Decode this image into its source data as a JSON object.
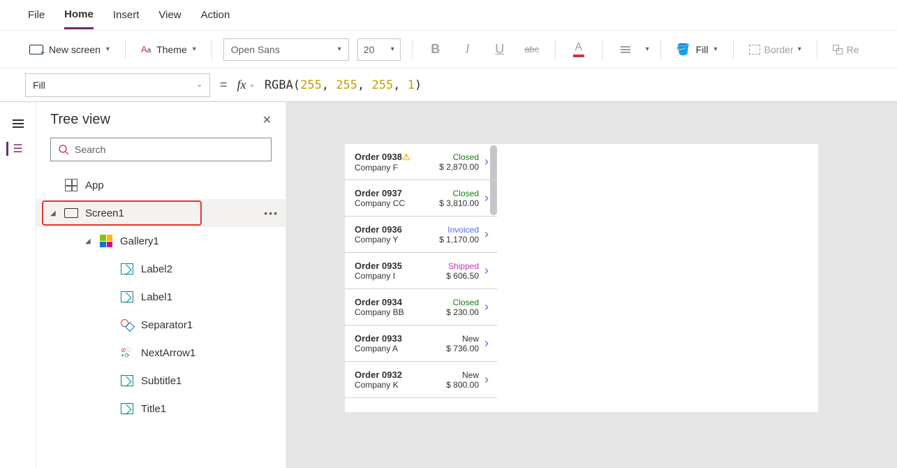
{
  "tabs": {
    "file": "File",
    "home": "Home",
    "insert": "Insert",
    "view": "View",
    "action": "Action"
  },
  "ribbon": {
    "newScreen": "New screen",
    "theme": "Theme",
    "font": "Open Sans",
    "size": "20",
    "fill": "Fill",
    "border": "Border",
    "reorder": "Re"
  },
  "formula": {
    "property": "Fill",
    "fn": "RGBA",
    "a1": "255",
    "a2": "255",
    "a3": "255",
    "a4": "1"
  },
  "panel": {
    "title": "Tree view",
    "searchPlaceholder": "Search",
    "app": "App",
    "screen": "Screen1",
    "gallery": "Gallery1",
    "nodes": [
      "Label2",
      "Label1",
      "Separator1",
      "NextArrow1",
      "Subtitle1",
      "Title1"
    ]
  },
  "orders": [
    {
      "id": "Order 0938",
      "company": "Company F",
      "status": "Closed",
      "price": "$ 2,870.00",
      "warn": true
    },
    {
      "id": "Order 0937",
      "company": "Company CC",
      "status": "Closed",
      "price": "$ 3,810.00",
      "warn": false
    },
    {
      "id": "Order 0936",
      "company": "Company Y",
      "status": "Invoiced",
      "price": "$ 1,170.00",
      "warn": false
    },
    {
      "id": "Order 0935",
      "company": "Company I",
      "status": "Shipped",
      "price": "$ 606.50",
      "warn": false
    },
    {
      "id": "Order 0934",
      "company": "Company BB",
      "status": "Closed",
      "price": "$ 230.00",
      "warn": false
    },
    {
      "id": "Order 0933",
      "company": "Company A",
      "status": "New",
      "price": "$ 736.00",
      "warn": false
    },
    {
      "id": "Order 0932",
      "company": "Company K",
      "status": "New",
      "price": "$ 800.00",
      "warn": false
    }
  ]
}
